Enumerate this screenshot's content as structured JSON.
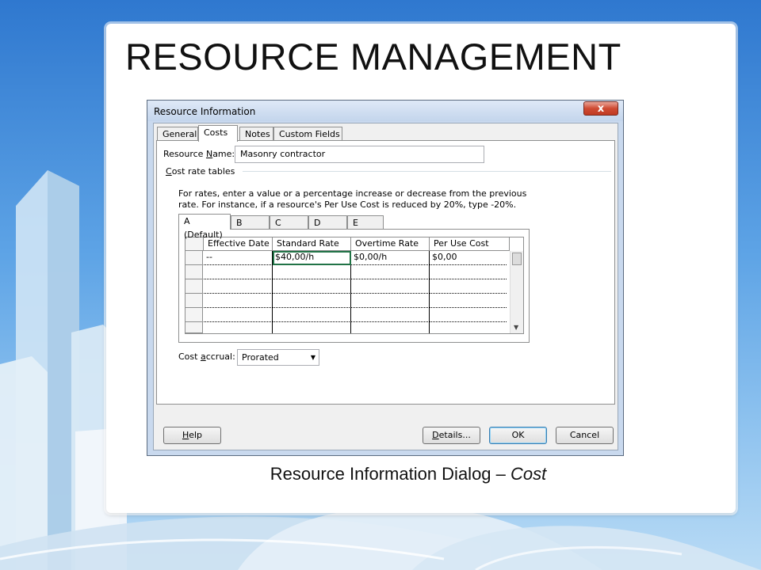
{
  "slide": {
    "title": "RESOURCE MANAGEMENT",
    "caption_main": "Resource Information Dialog – ",
    "caption_italic": "Cost"
  },
  "dialog": {
    "title": "Resource Information",
    "close_symbol": "x",
    "tabs": [
      {
        "label": "General",
        "active": false
      },
      {
        "label": "Costs",
        "active": true
      },
      {
        "label": "Notes",
        "active": false
      },
      {
        "label": "Custom Fields",
        "active": false
      }
    ],
    "resource_name": {
      "label_prefix": "Resource ",
      "label_accel": "N",
      "label_suffix": "ame:",
      "value": "Masonry contractor"
    },
    "cost_rate_tables": {
      "label_accel": "C",
      "label_rest": "ost rate tables"
    },
    "instruction_line1": "For rates, enter a value or a percentage increase or decrease from the previous",
    "instruction_line2": "rate. For instance, if a resource's Per Use Cost is reduced by 20%, type -20%.",
    "rate_tabs": [
      {
        "label": "A (Default)",
        "active": true
      },
      {
        "label": "B",
        "active": false
      },
      {
        "label": "C",
        "active": false
      },
      {
        "label": "D",
        "active": false
      },
      {
        "label": "E",
        "active": false
      }
    ],
    "grid": {
      "columns": [
        "Effective Date",
        "Standard Rate",
        "Overtime Rate",
        "Per Use Cost"
      ],
      "rows": [
        [
          "--",
          "$40,00/h",
          "$0,00/h",
          "$0,00"
        ],
        [
          "",
          "",
          "",
          ""
        ],
        [
          "",
          "",
          "",
          ""
        ],
        [
          "",
          "",
          "",
          ""
        ],
        [
          "",
          "",
          "",
          ""
        ],
        [
          "",
          "",
          "",
          ""
        ]
      ]
    },
    "cost_accrual": {
      "label_prefix": "Cost ",
      "label_accel": "a",
      "label_suffix": "ccrual:",
      "value": "Prorated"
    },
    "buttons": {
      "help_accel": "H",
      "help_rest": "elp",
      "details_accel": "D",
      "details_rest": "etails...",
      "ok": "OK",
      "cancel": "Cancel"
    }
  },
  "colors": {
    "selected_cell_border": "#217346",
    "close_button": "#cf4b33"
  }
}
